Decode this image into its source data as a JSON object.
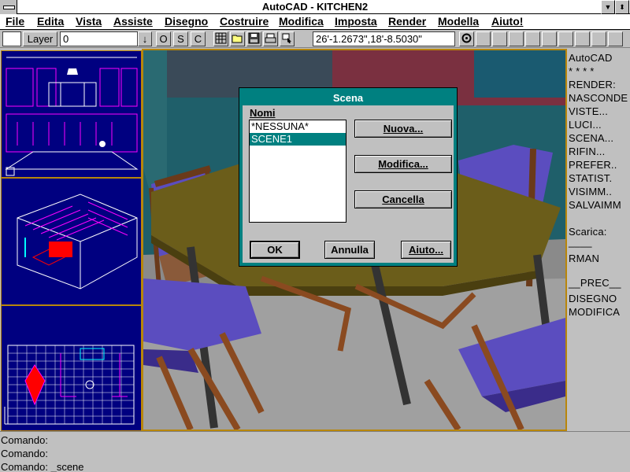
{
  "window": {
    "title": "AutoCAD - KITCHEN2",
    "minimize_glyph": "▼",
    "restore_glyph": "⬍"
  },
  "menu": [
    "File",
    "Edita",
    "Vista",
    "Assiste",
    "Disegno",
    "Costruire",
    "Modifica",
    "Imposta",
    "Render",
    "Modella",
    "Aiuto!"
  ],
  "toolbar": {
    "layer_label": "Layer",
    "layer_value": "0",
    "dropdown_glyph": "↓",
    "o_label": "O",
    "s_label": "S",
    "c_label": "C",
    "coords": "26'-1.2673\",18'-8.5030\""
  },
  "sidemenu": {
    "items": [
      "AutoCAD",
      "* * * *",
      "RENDER:",
      "NASCONDE",
      "VISTE...",
      "LUCI...",
      "SCENA...",
      "RIFIN...",
      "PREFER..",
      "STATIST.",
      "VISIMM..",
      "SALVAIMM",
      "",
      "Scarica:",
      "____",
      "RMAN",
      "",
      "__PREC__",
      "DISEGNO",
      "MODIFICA"
    ]
  },
  "command": {
    "lines": [
      "Comando:",
      "Comando:",
      "Comando: _scene"
    ]
  },
  "dialog": {
    "title": "Scena",
    "list_label": "Nomi",
    "list_items": [
      "*NESSUNA*",
      "SCENE1"
    ],
    "selected_index": 1,
    "new_button": "Nuova...",
    "modify_button": "Modifica...",
    "delete_button": "Cancella",
    "ok_button": "OK",
    "cancel_button": "Annulla",
    "help_button": "Aiuto..."
  },
  "colors": {
    "accent": "#008080",
    "viewport_bg": "#000080",
    "viewport_border": "#b8860b"
  }
}
